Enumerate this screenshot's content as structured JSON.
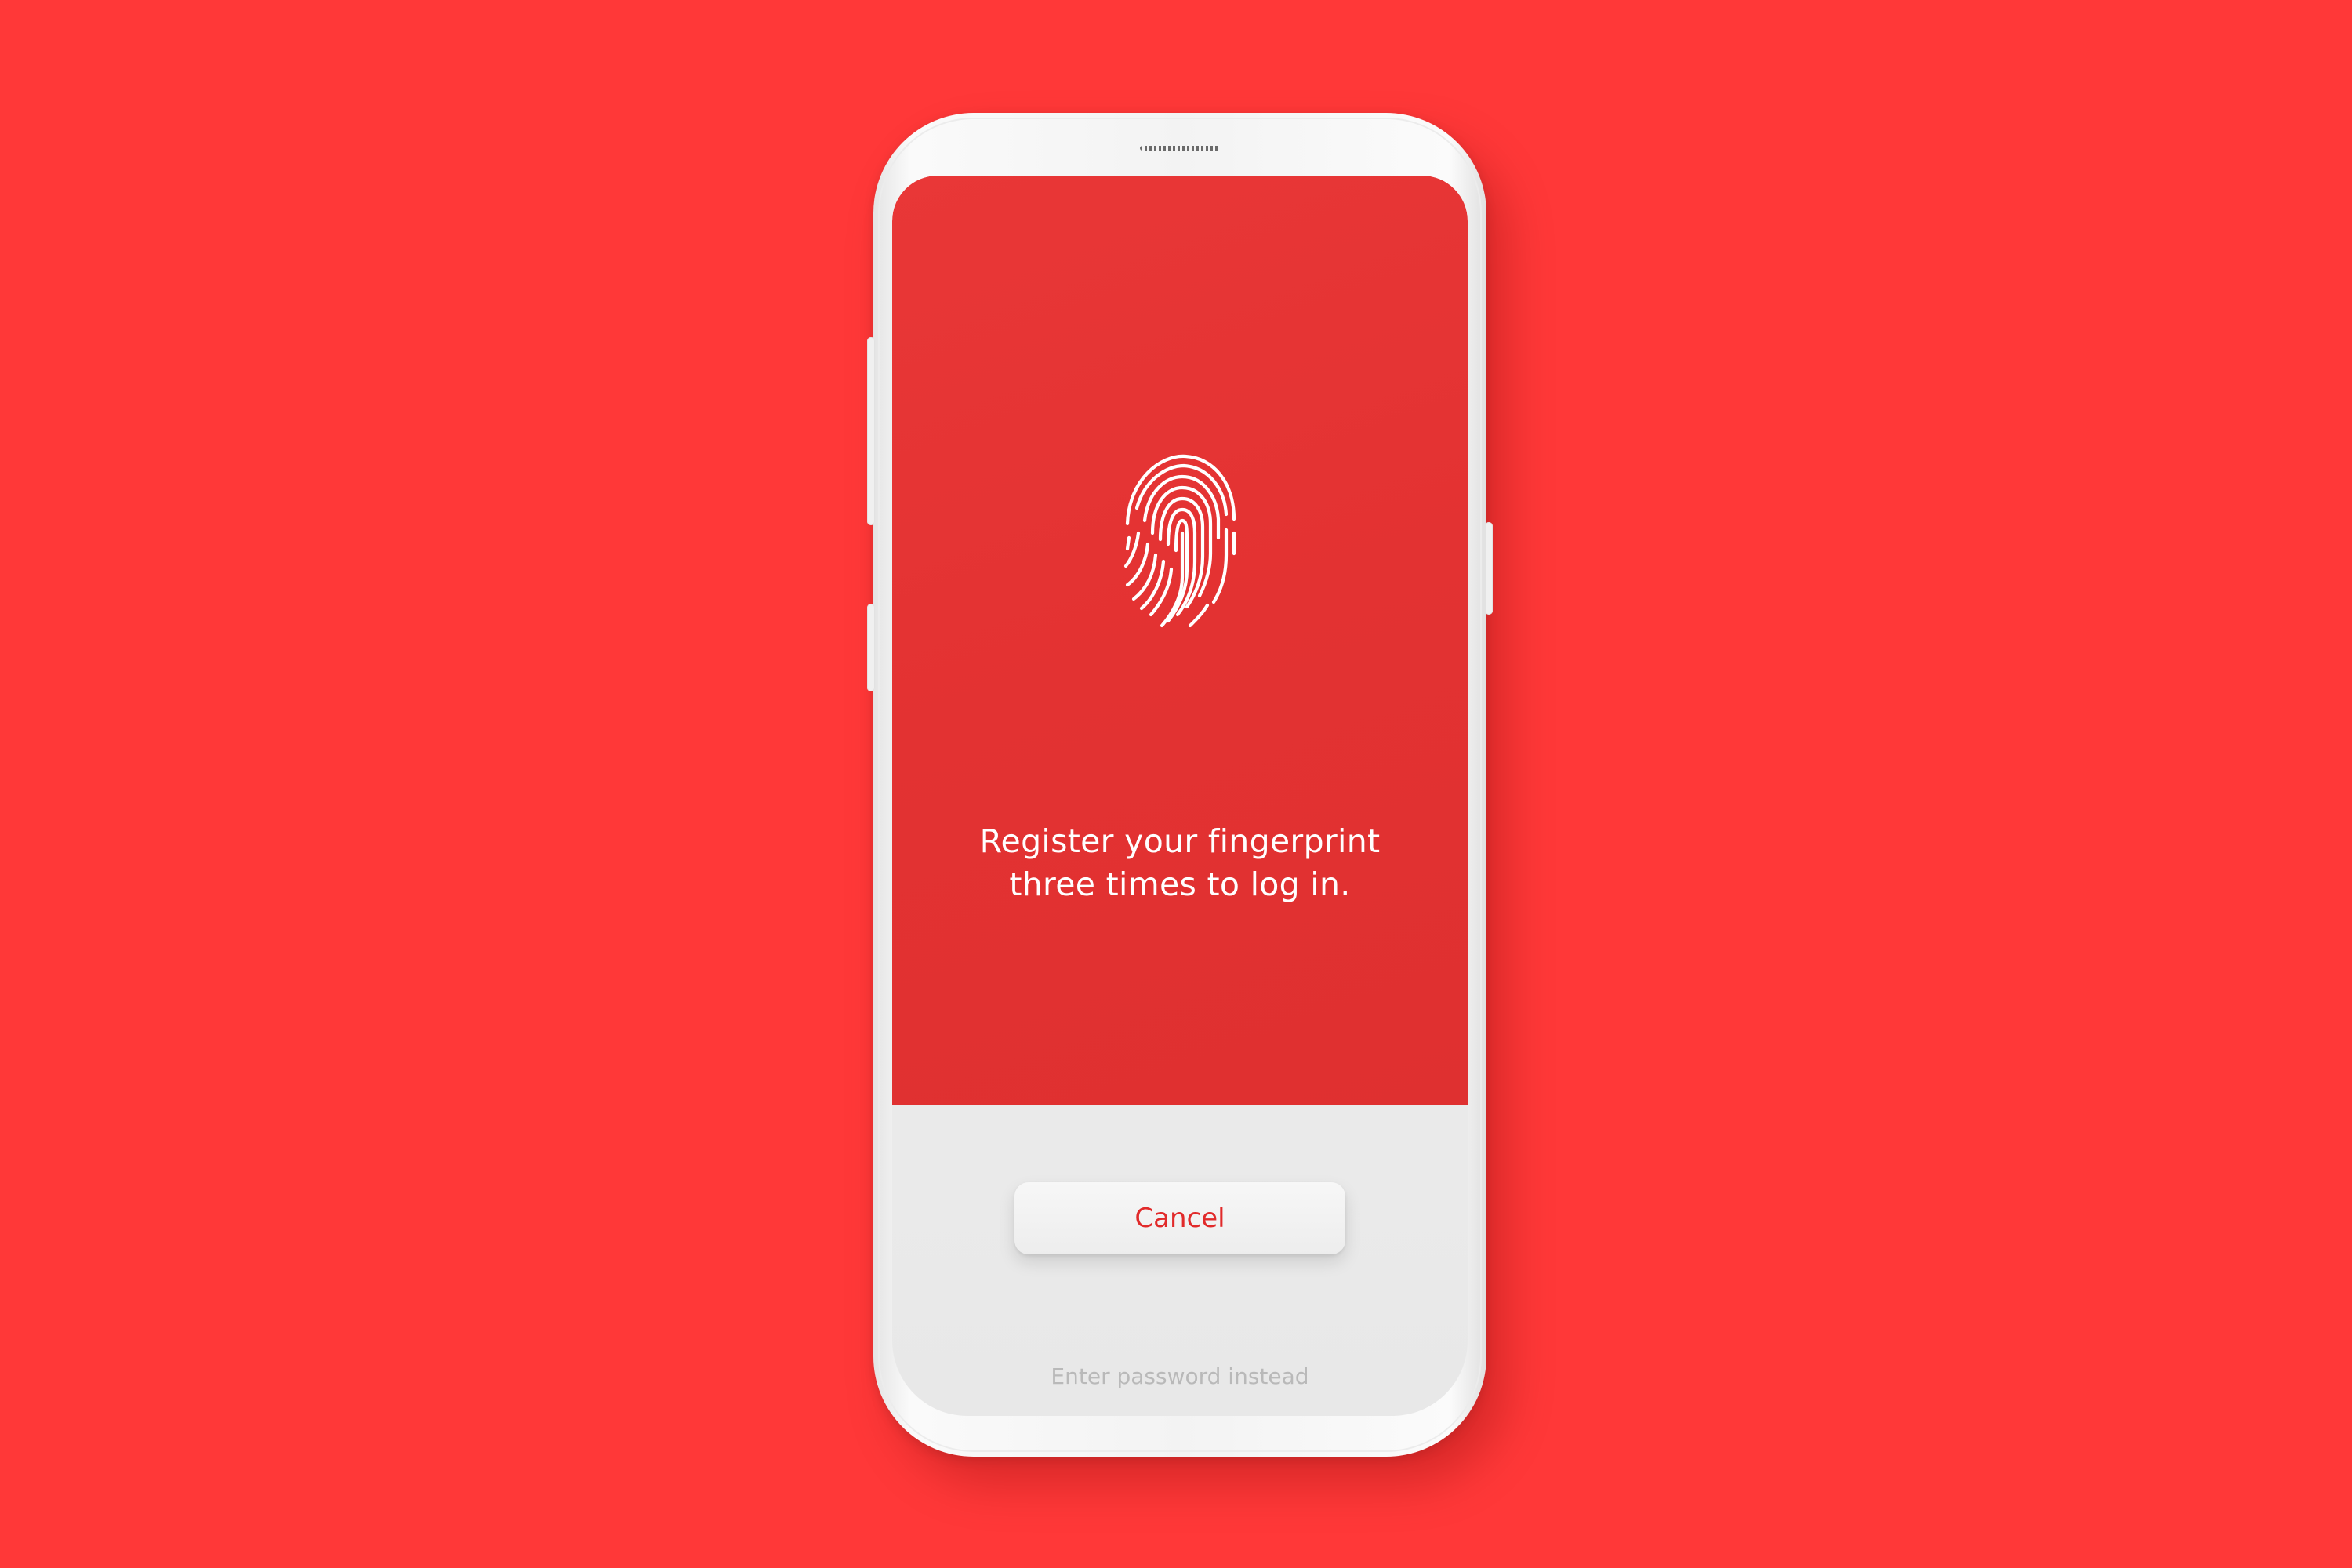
{
  "colors": {
    "background": "#ff3838",
    "screen_red": "#e43333",
    "accent_text": "#e12a2a",
    "muted_text": "#b9b9b9"
  },
  "screen": {
    "icon": "fingerprint-icon",
    "instruction_line_1": "Register your fingerprint",
    "instruction_line_2": "three times to log in.",
    "cancel_label": "Cancel",
    "alternate_label": "Enter password instead"
  }
}
